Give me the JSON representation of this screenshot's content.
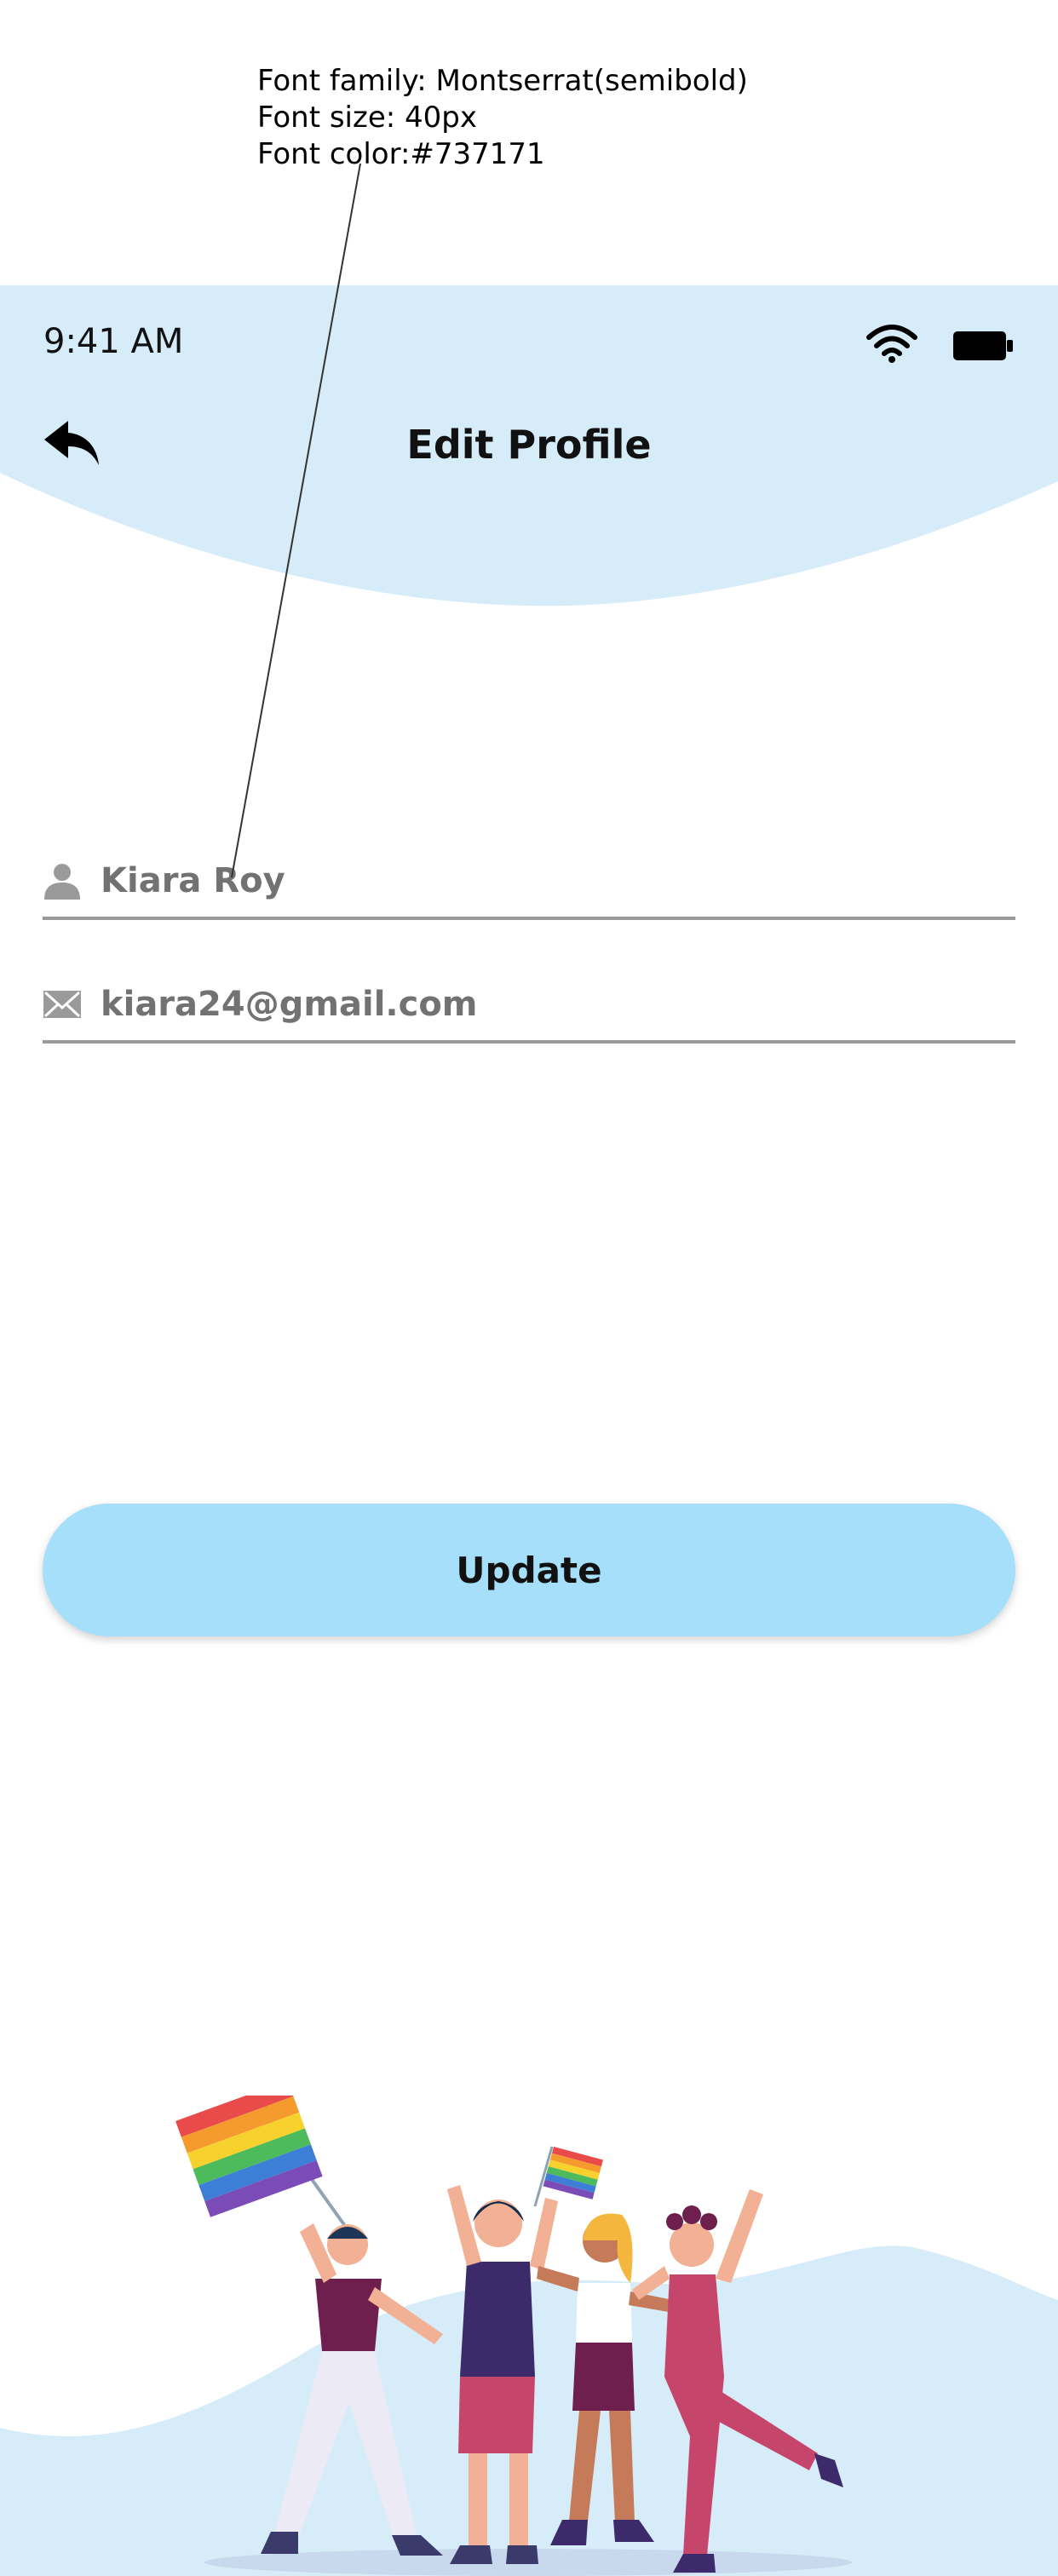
{
  "annotation": {
    "font_family": "Font family: Montserrat(semibold)",
    "font_size": "Font size: 40px",
    "font_color": "Font color:#737171"
  },
  "status_bar": {
    "time": "9:41 AM",
    "icons": [
      "wifi-icon",
      "battery-icon"
    ]
  },
  "header": {
    "title": "Edit Profile",
    "back_icon": "back-arrow-icon"
  },
  "form": {
    "name": {
      "value": "Kiara Roy",
      "icon": "person-icon"
    },
    "email": {
      "value": "kiara24@gmail.com",
      "icon": "mail-icon"
    }
  },
  "actions": {
    "update_label": "Update"
  },
  "colors": {
    "header_bg": "#d6ecf8",
    "input_text": "#737171",
    "button_bg": "#a6dff9",
    "underline": "#9a9a9a"
  }
}
